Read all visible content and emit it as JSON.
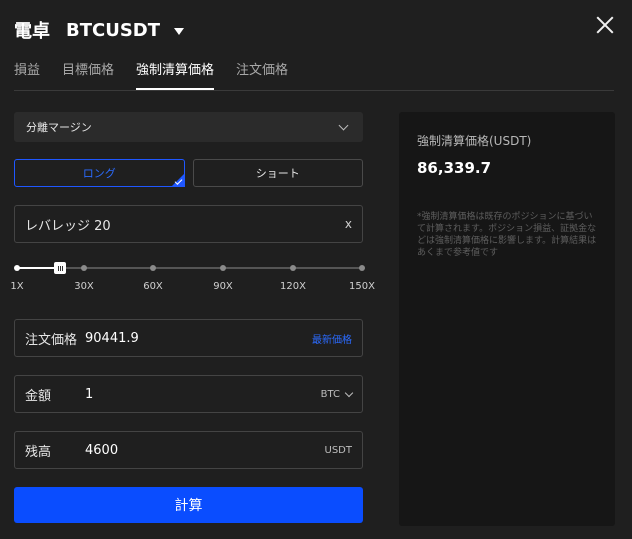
{
  "header": {
    "title": "電卓",
    "symbol": "BTCUSDT"
  },
  "tabs": [
    "損益",
    "目標価格",
    "強制清算価格",
    "注文価格"
  ],
  "margin_mode": {
    "selected": "分離マージン"
  },
  "sides": {
    "long": "ロング",
    "short": "ショート",
    "selected": "long"
  },
  "leverage": {
    "text": "レバレッジ 20",
    "clear": "x",
    "value_fraction": 0.13
  },
  "slider_ticks": [
    "1X",
    "30X",
    "60X",
    "90X",
    "120X",
    "150X"
  ],
  "fields": {
    "price": {
      "label": "注文価格",
      "value": "90441.9",
      "suffix": "最新価格"
    },
    "amount": {
      "label": "金額",
      "value": "1",
      "suffix": "BTC"
    },
    "balance": {
      "label": "残高",
      "value": "4600",
      "suffix": "USDT"
    }
  },
  "calculate_button": "計算",
  "result": {
    "title": "強制清算価格(USDT)",
    "value": "86,339.7",
    "note": "*強制清算価格は既存のポジションに基づいて計算されます。ポジション損益、証拠金などは強制清算価格に影響します。計算結果はあくまで参考値です"
  },
  "colors": {
    "accent": "#0a4dff",
    "background": "#1f1f1f",
    "panel": "#161616"
  }
}
